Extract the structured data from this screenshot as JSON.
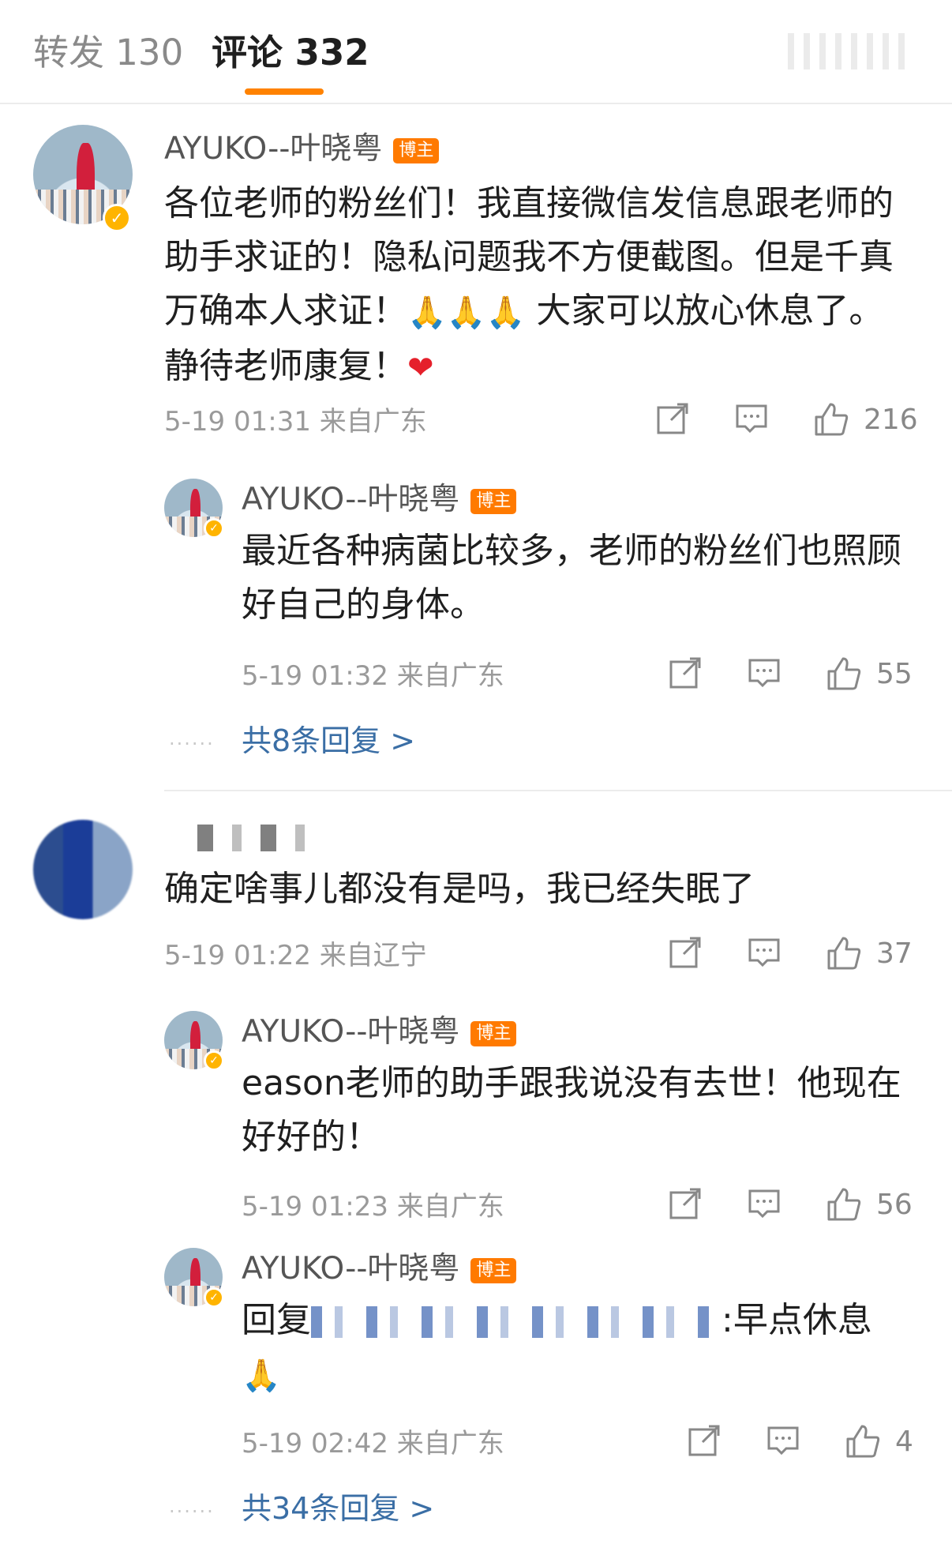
{
  "tabs": {
    "repost": "转发 130",
    "comments": "评论 332"
  },
  "colors": {
    "accent": "#ff8200",
    "link": "#3a6ea5",
    "badge": "#ff7a00",
    "verified": "#ffb400"
  },
  "comments": [
    {
      "author": "AYUKO--叶晓粤",
      "badge": "博主",
      "verified_icon": "✓",
      "text": "各位老师的粉丝们！我直接微信发信息跟老师的助手求证的！隐私问题我不方便截图。但是千真万确本人求证！",
      "emoji": "🙏🙏🙏",
      "text_after": " 大家可以放心休息了。静待老师康复！",
      "emoji_end": "❤",
      "meta": "5-19 01:31 来自广东",
      "likes": "216",
      "replies": [
        {
          "author": "AYUKO--叶晓粤",
          "badge": "博主",
          "text": "最近各种病菌比较多，老师的粉丝们也照顾好自己的身体。",
          "meta": "5-19 01:32 来自广东",
          "likes": "55"
        }
      ],
      "more_replies": "共8条回复 >",
      "dots": "······"
    },
    {
      "author": "",
      "text": "确定啥事儿都没有是吗，我已经失眠了",
      "meta": "5-19 01:22 来自辽宁",
      "likes": "37",
      "replies": [
        {
          "author": "AYUKO--叶晓粤",
          "badge": "博主",
          "text": "eason老师的助手跟我说没有去世！他现在好好的！",
          "meta": "5-19 01:23 来自广东",
          "likes": "56"
        },
        {
          "author": "AYUKO--叶晓粤",
          "badge": "博主",
          "reply_prefix": "回复",
          "reply_suffix": ":早点休息",
          "emoji": "🙏",
          "meta": "5-19 02:42 来自广东",
          "likes": "4"
        }
      ],
      "more_replies": "共34条回复 >",
      "dots": "······"
    }
  ],
  "icons": [
    "share-icon",
    "comment-icon",
    "like-icon"
  ]
}
